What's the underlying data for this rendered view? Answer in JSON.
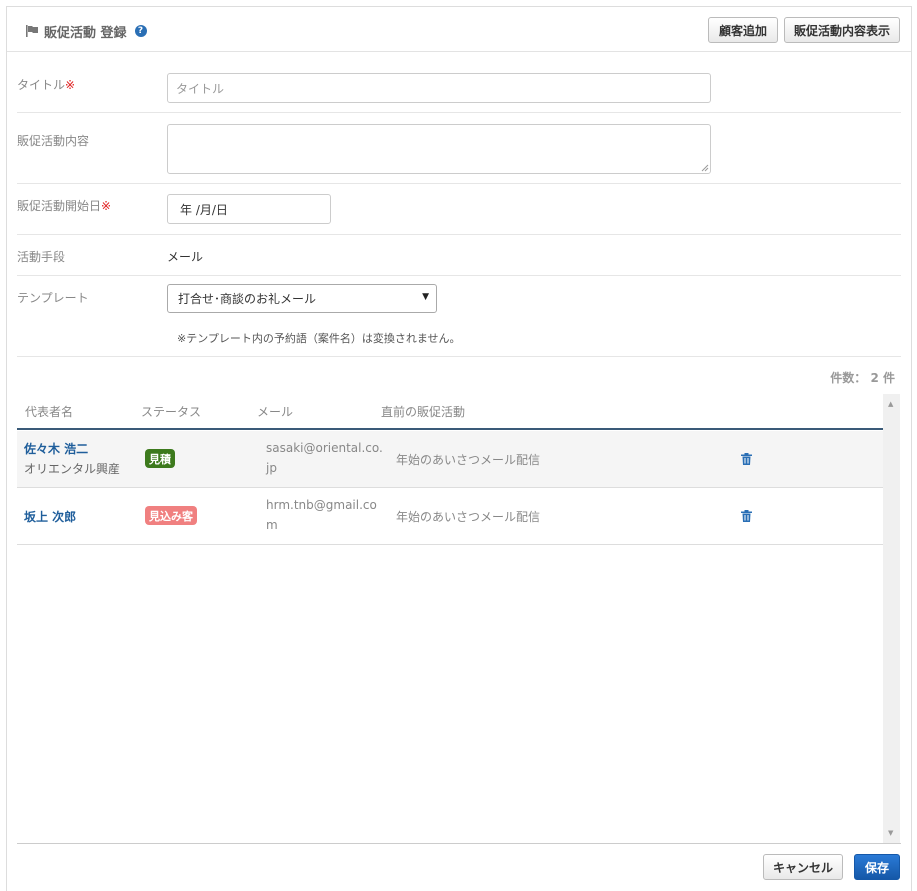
{
  "header": {
    "title": "販促活動 登録",
    "help_glyph": "?",
    "add_customer_label": "顧客追加",
    "show_content_label": "販促活動内容表示"
  },
  "form": {
    "title_label": "タイトル",
    "title_required": "※",
    "title_placeholder": "タイトル",
    "content_label": "販促活動内容",
    "start_date_label": "販促活動開始日",
    "start_date_required": "※",
    "start_date_value": "年 /月/日",
    "method_label": "活動手段",
    "method_value": "メール",
    "template_label": "テンプレート",
    "template_selected": "打合せ･商談のお礼メール",
    "template_note": "※テンプレート内の予約語（案件名）は変換されません。"
  },
  "count_text": "件数： 2 件",
  "table": {
    "columns": [
      "代表者名",
      "ステータス",
      "メール",
      "直前の販促活動"
    ],
    "rows": [
      {
        "name": "佐々木 浩二",
        "company": "オリエンタル興産",
        "status": "見積",
        "status_color": "#3d7a1d",
        "email": "sasaki@oriental.co.jp",
        "last_activity": "年始のあいさつメール配信"
      },
      {
        "name": "坂上 次郎",
        "company": "",
        "status": "見込み客",
        "status_color": "#f08080",
        "email": "hrm.tnb@gmail.com",
        "last_activity": "年始のあいさつメール配信"
      }
    ]
  },
  "footer": {
    "cancel_label": "キャンセル",
    "save_label": "保存"
  },
  "icons": {
    "flag": "flag-icon",
    "help": "help-icon",
    "trash": "trash-icon",
    "caret": "chevron-down-icon"
  }
}
